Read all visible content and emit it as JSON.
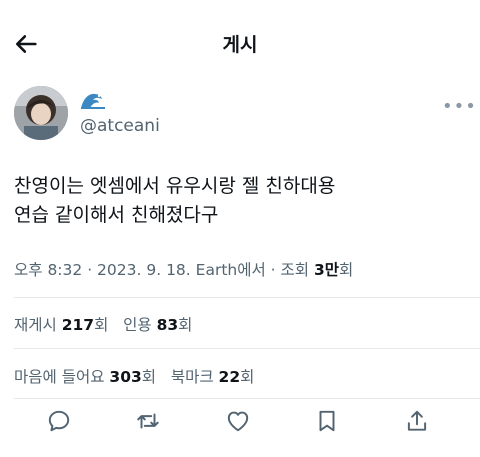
{
  "header": {
    "title": "게시"
  },
  "author": {
    "handle": "@atceani"
  },
  "post": {
    "line1": "찬영이는 엣셈에서 유우시랑 젤 친하대용",
    "line2": "연습 같이해서 친해졌다구"
  },
  "meta": {
    "time": "오후 8:32",
    "sep1": " · ",
    "date": "2023. 9. 18.",
    "sep2": " ",
    "source": "Earth에서",
    "sep3": " · ",
    "views_label": "조회 ",
    "views_value": "3만",
    "views_suffix": "회"
  },
  "stats": {
    "retweets_label": "재게시 ",
    "retweets_value": "217",
    "retweets_suffix": "회",
    "quotes_label": "인용 ",
    "quotes_value": "83",
    "quotes_suffix": "회",
    "likes_label": "마음에 들어요 ",
    "likes_value": "303",
    "likes_suffix": "회",
    "bookmarks_label": "북마크 ",
    "bookmarks_value": "22",
    "bookmarks_suffix": "회"
  },
  "icons": {
    "back": "arrow-left-icon",
    "more": "more-horizontal-icon",
    "reply": "reply-icon",
    "retweet": "retweet-icon",
    "like": "heart-icon",
    "bookmark": "bookmark-icon",
    "share": "share-icon"
  },
  "colors": {
    "text": "#0f1419",
    "secondary": "#536471",
    "divider": "#e6e9ec"
  }
}
